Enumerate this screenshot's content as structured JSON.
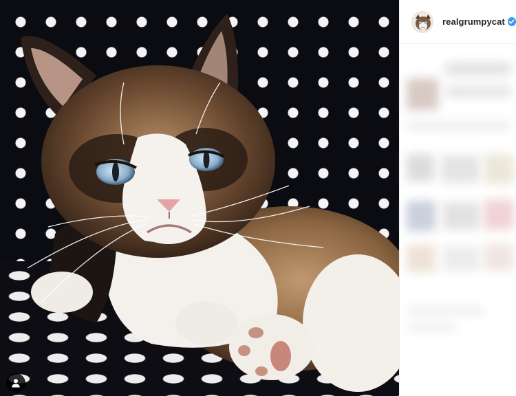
{
  "post": {
    "username": "realgrumpycat",
    "verified": true
  },
  "icons": {
    "verified": "verified-check-icon",
    "user_tags": "user-silhouette-icon"
  },
  "colors": {
    "verified_blue": "#3897f0",
    "username_text": "#262626",
    "photo_background": "#0b0b12"
  }
}
